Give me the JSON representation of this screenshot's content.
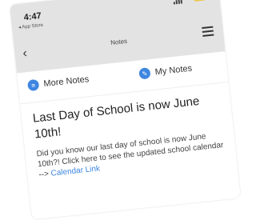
{
  "status_bar": {
    "time": "4:47",
    "back_app": "◂ App Store"
  },
  "header": {
    "title": "Notes"
  },
  "nav": {
    "more_notes": "More Notes",
    "my_notes": "My Notes"
  },
  "note": {
    "heading": "Last Day of School is now June 10th!",
    "body": "Did you know our last day of school is now June 10th?! Click here to see the updated school calendar --> ",
    "link_text": "Calendar Link"
  },
  "colors": {
    "accent": "#3e86e0",
    "battery": "#f2c744",
    "header_bg": "#e3e3e3"
  },
  "icons": {
    "more_notes": "list-icon",
    "my_notes": "pencil-icon",
    "menu": "hamburger-menu-icon",
    "back": "chevron-left-icon"
  }
}
